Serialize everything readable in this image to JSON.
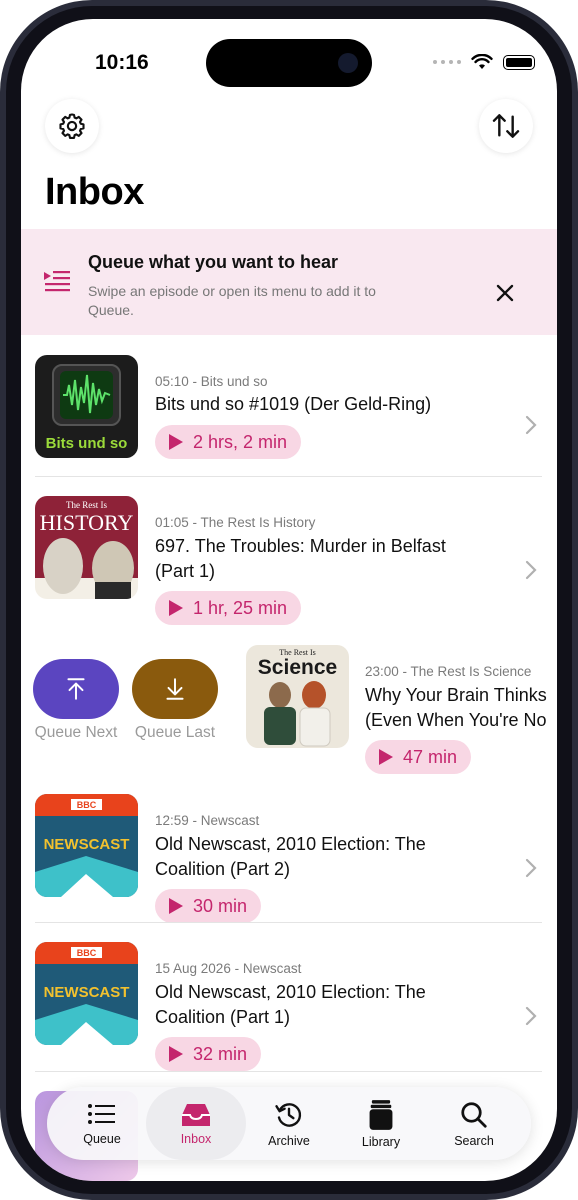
{
  "status": {
    "time": "10:16"
  },
  "header": {
    "title": "Inbox"
  },
  "banner": {
    "title": "Queue what you want to hear",
    "subtitle": "Swipe an episode or open its menu to add it to Queue."
  },
  "episodes": [
    {
      "meta": "05:10 - Bits und so",
      "title": "Bits und so #1019 (Der Geld-Ring)",
      "duration": "2 hrs, 2 min",
      "art_text": "Bits und so"
    },
    {
      "meta": "01:05 - The Rest Is History",
      "title_line1": "697. The Troubles: Murder in Belfast",
      "title_line2": "(Part 1)",
      "duration": "1 hr, 25 min",
      "art_text_top": "The Rest Is",
      "art_text": "HISTORY"
    },
    {
      "meta": "23:00 - The Rest Is Science",
      "title_line1": "Why Your Brain Thinks",
      "title_line2": "(Even When You're No",
      "duration": "47 min",
      "art_text_top": "The Rest Is",
      "art_text": "Science"
    },
    {
      "meta": "12:59 - Newscast",
      "title_line1": "Old Newscast, 2010 Election: The",
      "title_line2": "Coalition (Part 2)",
      "duration": "30 min",
      "art_badge": "BBC",
      "art_text": "NEWSCAST"
    },
    {
      "meta": "15 Aug 2026 - Newscast",
      "title_line1": "Old Newscast, 2010 Election: The",
      "title_line2": "Coalition (Part 1)",
      "duration": "32 min",
      "art_badge": "BBC",
      "art_text": "NEWSCAST"
    }
  ],
  "swipe_actions": {
    "queue_next": "Queue Next",
    "queue_last": "Queue Last"
  },
  "tabs": [
    {
      "label": "Queue",
      "icon": "queue-list-icon"
    },
    {
      "label": "Inbox",
      "icon": "inbox-tray-icon",
      "active": true
    },
    {
      "label": "Archive",
      "icon": "archive-clock-icon"
    },
    {
      "label": "Library",
      "icon": "library-books-icon"
    },
    {
      "label": "Search",
      "icon": "magnifier-icon"
    }
  ],
  "colors": {
    "accent": "#c4266d",
    "pill_bg": "#f8d7e4",
    "banner_bg": "#f9e8f0",
    "queue_next": "#5b45c0",
    "queue_last": "#8a5a0d"
  }
}
